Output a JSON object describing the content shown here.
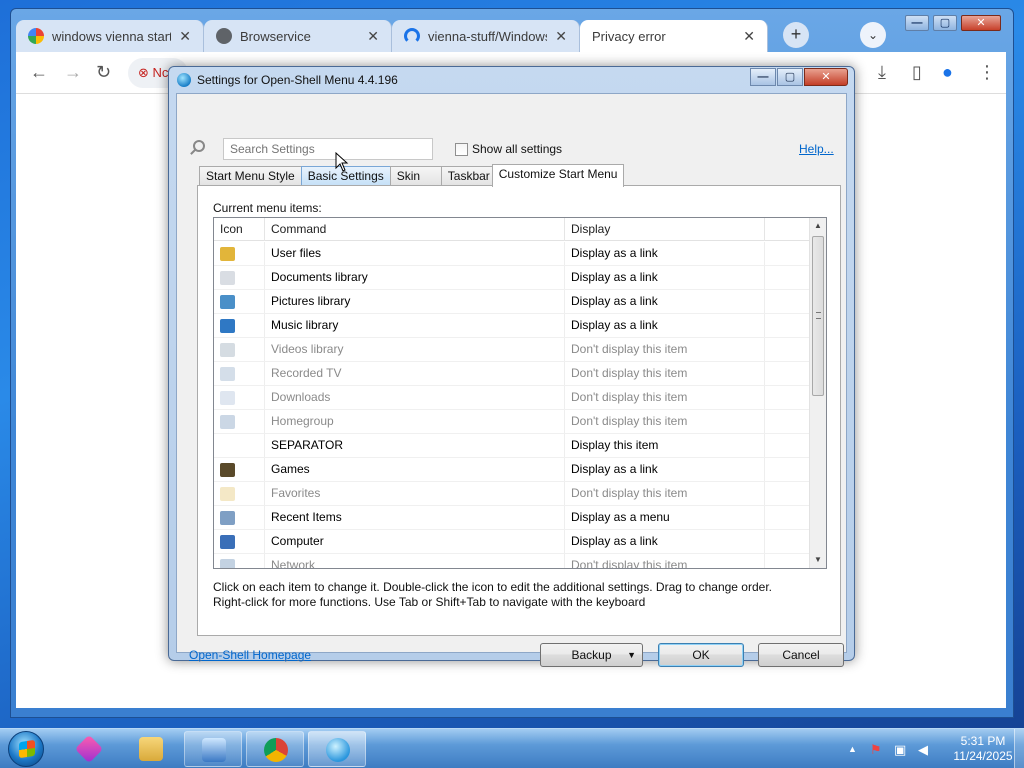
{
  "browser": {
    "tabs": [
      {
        "title": "windows vienna start m",
        "favicon": "google-icon",
        "active": false
      },
      {
        "title": "Browservice",
        "favicon": "globe-icon",
        "active": false
      },
      {
        "title": "vienna-stuff/Windows",
        "favicon": "arc-icon",
        "active": false
      },
      {
        "title": "Privacy error",
        "favicon": "",
        "active": true
      }
    ],
    "new_tab_symbol": "+",
    "tab_search_symbol": "⌄",
    "omnibox_text": "Nc",
    "window_controls": {
      "minimize": "—",
      "maximize": "▢",
      "close": "✕"
    }
  },
  "dialog": {
    "title": "Settings for Open-Shell Menu 4.4.196",
    "search_placeholder": "Search Settings",
    "show_all_label": "Show all settings",
    "help_link": "Help...",
    "tabs": [
      "Start Menu Style",
      "Basic Settings",
      "Skin",
      "Taskbar",
      "Customize Start Menu"
    ],
    "panel_label": "Current menu items:",
    "columns": [
      "Icon",
      "Command",
      "Display"
    ],
    "rows": [
      {
        "command": "User files",
        "display": "Display as a link",
        "enabled": true,
        "icon": "user-folder-icon",
        "color": "#e2b53a"
      },
      {
        "command": "Documents library",
        "display": "Display as a link",
        "enabled": true,
        "icon": "document-icon",
        "color": "#d9dde3"
      },
      {
        "command": "Pictures library",
        "display": "Display as a link",
        "enabled": true,
        "icon": "pictures-icon",
        "color": "#4a8fc8"
      },
      {
        "command": "Music library",
        "display": "Display as a link",
        "enabled": true,
        "icon": "music-icon",
        "color": "#2f78c4"
      },
      {
        "command": "Videos library",
        "display": "Don't display this item",
        "enabled": false,
        "icon": "video-icon",
        "color": "#b9c4cf"
      },
      {
        "command": "Recorded TV",
        "display": "Don't display this item",
        "enabled": false,
        "icon": "tv-icon",
        "color": "#b8c8da"
      },
      {
        "command": "Downloads",
        "display": "Don't display this item",
        "enabled": false,
        "icon": "downloads-icon",
        "color": "#c9d6e6"
      },
      {
        "command": "Homegroup",
        "display": "Don't display this item",
        "enabled": false,
        "icon": "homegroup-icon",
        "color": "#a8bdd3"
      },
      {
        "command": "SEPARATOR",
        "display": "Display this item",
        "enabled": true,
        "icon": "",
        "color": ""
      },
      {
        "command": "Games",
        "display": "Display as a link",
        "enabled": true,
        "icon": "games-icon",
        "color": "#5a4a2a"
      },
      {
        "command": "Favorites",
        "display": "Don't display this item",
        "enabled": false,
        "icon": "star-icon",
        "color": "#ecd9a0"
      },
      {
        "command": "Recent Items",
        "display": "Display as a menu",
        "enabled": true,
        "icon": "recent-icon",
        "color": "#7f9fc4"
      },
      {
        "command": "Computer",
        "display": "Display as a link",
        "enabled": true,
        "icon": "computer-icon",
        "color": "#3a6fb8"
      },
      {
        "command": "Network",
        "display": "Don't display this item",
        "enabled": false,
        "icon": "network-icon",
        "color": "#9bb4cf"
      }
    ],
    "hint_line1": "Click on each item to change it. Double-click the icon to edit the additional settings. Drag to change order.",
    "hint_line2": "Right-click for more functions. Use Tab or Shift+Tab to navigate with the keyboard",
    "homepage_link": "Open-Shell Homepage",
    "buttons": {
      "backup": "Backup",
      "ok": "OK",
      "cancel": "Cancel"
    }
  },
  "taskbar": {
    "time": "5:31 PM",
    "date": "11/24/2025",
    "items": [
      "media-player-icon",
      "explorer-icon",
      "remote-desktop-icon",
      "chrome-icon",
      "open-shell-icon"
    ]
  }
}
